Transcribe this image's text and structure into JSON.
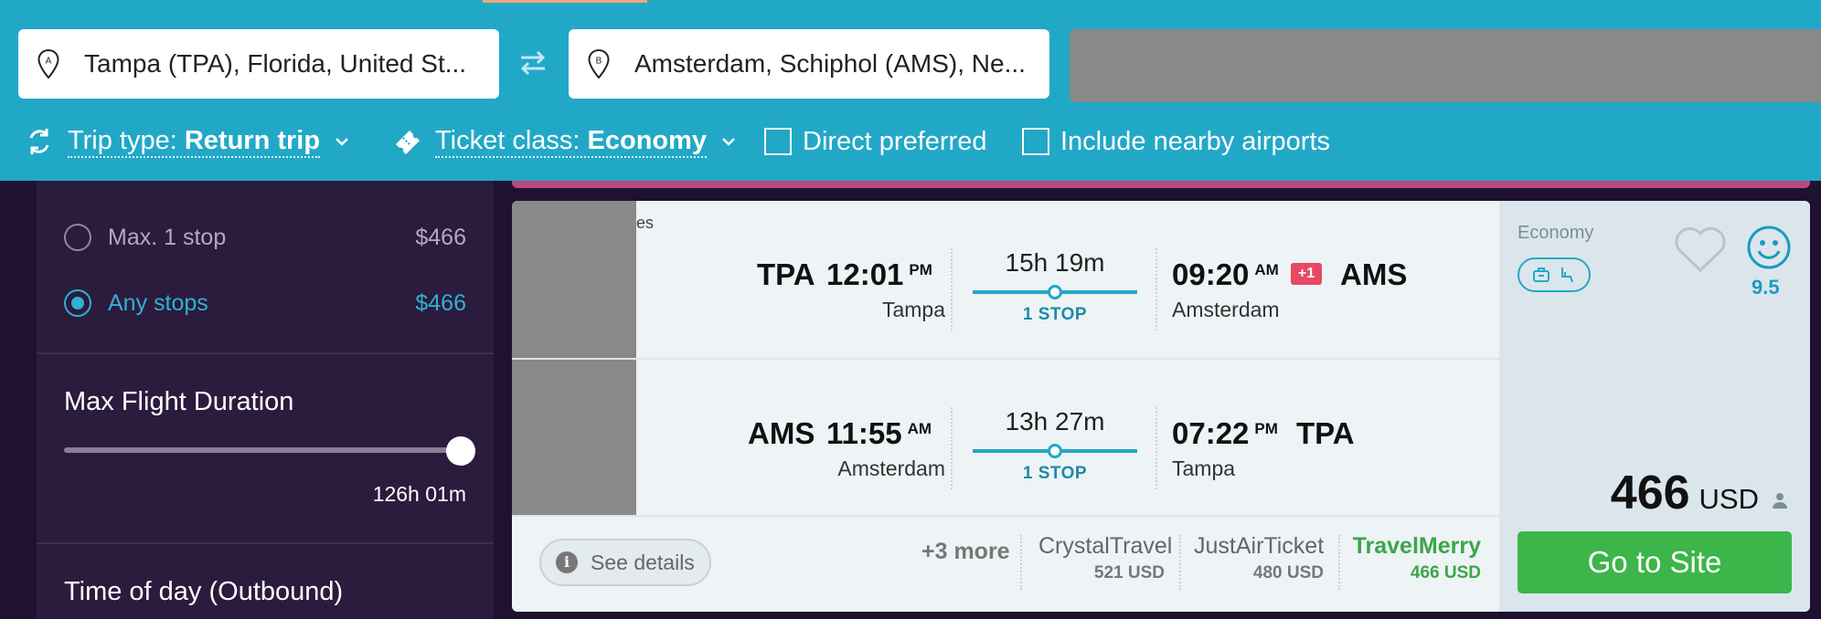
{
  "search": {
    "origin": "Tampa (TPA), Florida, United St...",
    "origin_marker": "A",
    "destination": "Amsterdam, Schiphol (AMS), Ne...",
    "destination_marker": "B"
  },
  "options": {
    "trip_type_label": "Trip type:",
    "trip_type_value": "Return trip",
    "ticket_class_label": "Ticket class:",
    "ticket_class_value": "Economy",
    "direct_preferred": "Direct preferred",
    "nearby_airports": "Include nearby airports",
    "direct_checked": false,
    "nearby_checked": false
  },
  "sidebar": {
    "stops": [
      {
        "label": "Max. 1 stop",
        "price": "$466",
        "selected": false
      },
      {
        "label": "Any stops",
        "price": "$466",
        "selected": true
      }
    ],
    "max_duration": {
      "title": "Max Flight Duration",
      "value": "126h 01m",
      "slider_fraction": 1.0
    },
    "time_of_day_title": "Time of day (Outbound)"
  },
  "result": {
    "airline_clip": "es",
    "outbound": {
      "from_code": "TPA",
      "dep_time": "12:01",
      "dep_ampm": "PM",
      "from_city": "Tampa",
      "duration": "15h 19m",
      "stops": "1 STOP",
      "arr_time": "09:20",
      "arr_ampm": "AM",
      "day_offset": "+1",
      "to_code": "AMS",
      "to_city": "Amsterdam"
    },
    "return": {
      "from_code": "AMS",
      "dep_time": "11:55",
      "dep_ampm": "AM",
      "from_city": "Amsterdam",
      "duration": "13h 27m",
      "stops": "1 STOP",
      "arr_time": "07:22",
      "arr_ampm": "PM",
      "to_code": "TPA",
      "to_city": "Tampa"
    },
    "see_details": "See details",
    "more_providers": "+3 more",
    "providers": [
      {
        "name": "CrystalTravel",
        "price": "521 USD"
      },
      {
        "name": "JustAirTicket",
        "price": "480 USD"
      },
      {
        "name": "TravelMerry",
        "price": "466 USD"
      }
    ],
    "cabin": "Economy",
    "score": "9.5",
    "price": "466",
    "currency": "USD",
    "cta": "Go to Site"
  },
  "colors": {
    "topbar": "#22a8c7",
    "sidebar": "#2b1b3d",
    "accent": "#2fb1d4",
    "cta": "#3cb54a",
    "day_offset_badge": "#e84862"
  },
  "icons": [
    "location-pin-icon",
    "swap-icon",
    "trip-type-icon",
    "ticket-icon",
    "chevron-down-icon",
    "info-icon",
    "bag-icon",
    "seat-icon",
    "heart-icon",
    "smiley-icon",
    "person-icon"
  ]
}
